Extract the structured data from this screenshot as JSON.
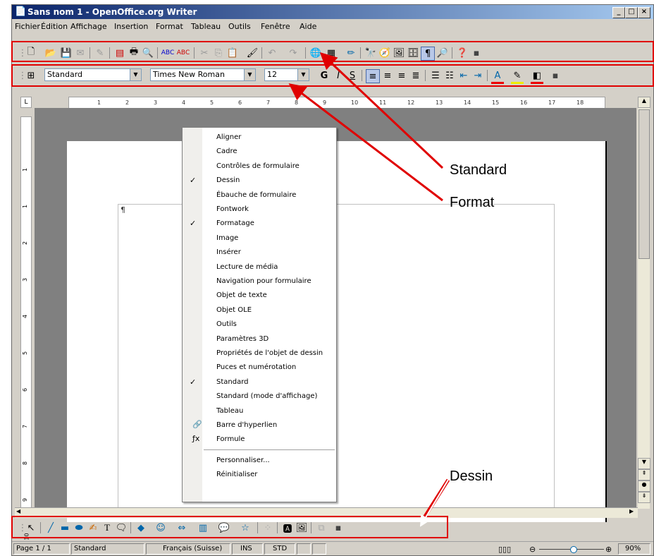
{
  "window": {
    "title": "Sans nom 1 - OpenOffice.org Writer"
  },
  "menubar": [
    "Fichier",
    "Édition",
    "Affichage",
    "Insertion",
    "Format",
    "Tableau",
    "Outils",
    "Fenêtre",
    "Aide"
  ],
  "format_toolbar": {
    "style": "Standard",
    "font": "Times New Roman",
    "size": "12",
    "bold": "G",
    "italic": "I",
    "underline": "S"
  },
  "ruler": {
    "h_marks": [
      "1",
      "2",
      "3",
      "4",
      "5",
      "6",
      "7",
      "8",
      "9",
      "10",
      "11",
      "12",
      "13",
      "14",
      "15",
      "16",
      "17",
      "18"
    ],
    "v_marks": [
      "1",
      "1",
      "2",
      "3",
      "4",
      "5",
      "6",
      "7",
      "8",
      "9",
      "10"
    ]
  },
  "context_menu": {
    "items": [
      {
        "label": "Aligner",
        "checked": false
      },
      {
        "label": "Cadre",
        "checked": false
      },
      {
        "label": "Contrôles de formulaire",
        "checked": false
      },
      {
        "label": "Dessin",
        "checked": true
      },
      {
        "label": "Ébauche de formulaire",
        "checked": false
      },
      {
        "label": "Fontwork",
        "checked": false
      },
      {
        "label": "Formatage",
        "checked": true
      },
      {
        "label": "Image",
        "checked": false
      },
      {
        "label": "Insérer",
        "checked": false
      },
      {
        "label": "Lecture de média",
        "checked": false
      },
      {
        "label": "Navigation pour formulaire",
        "checked": false
      },
      {
        "label": "Objet de texte",
        "checked": false
      },
      {
        "label": "Objet OLE",
        "checked": false
      },
      {
        "label": "Outils",
        "checked": false
      },
      {
        "label": "Paramètres 3D",
        "checked": false
      },
      {
        "label": "Propriétés de l'objet de dessin",
        "checked": false
      },
      {
        "label": "Puces et numérotation",
        "checked": false
      },
      {
        "label": "Standard",
        "checked": true
      },
      {
        "label": "Standard (mode d'affichage)",
        "checked": false
      },
      {
        "label": "Tableau",
        "checked": false
      },
      {
        "label": "Barre d'hyperlien",
        "checked": false,
        "icon": "hyperlink-icon"
      },
      {
        "label": "Formule",
        "checked": false,
        "icon": "formula-icon"
      }
    ],
    "footer_items": [
      "Personnaliser...",
      "Réinitialiser"
    ],
    "check_glyph": "✓"
  },
  "callouts": {
    "standard": "Standard",
    "format": "Format",
    "dessin": "Dessin"
  },
  "statusbar": {
    "page": "Page 1 / 1",
    "style": "Standard",
    "language": "Français (Suisse)",
    "mode": "INS",
    "selection": "STD",
    "zoom": "90%"
  },
  "colors": {
    "highlight": "#e00000",
    "title_start": "#0a246a",
    "title_end": "#a6caf0"
  }
}
